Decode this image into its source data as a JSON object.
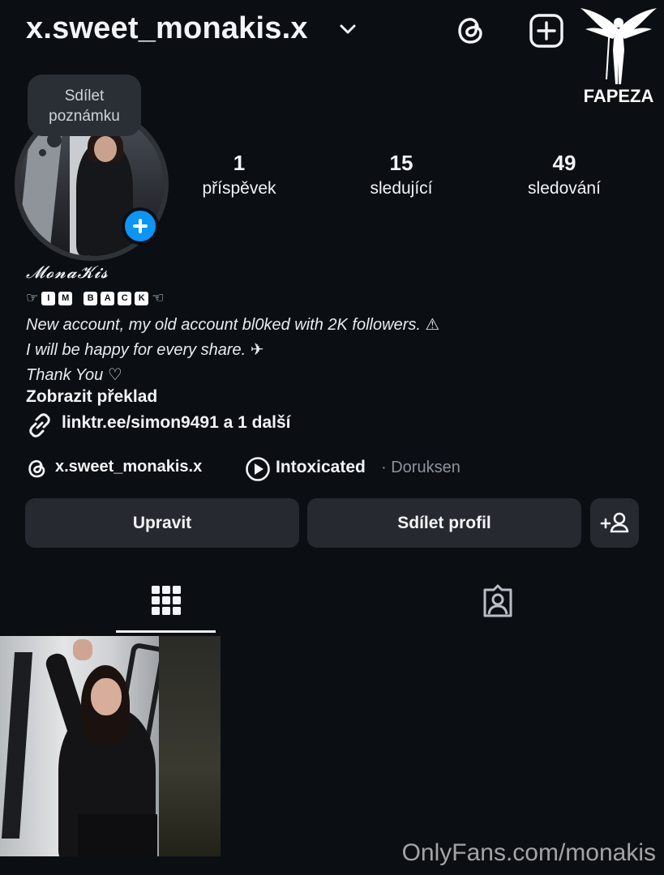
{
  "header": {
    "username": "x.sweet_monakis.x",
    "icons": [
      "chevron-down-icon",
      "threads-icon",
      "add-post-icon"
    ],
    "watermark": "FAPEZA"
  },
  "profile": {
    "note_label": "Sdílet poznámku",
    "stats": [
      {
        "count": "1",
        "label": "příspěvek"
      },
      {
        "count": "15",
        "label": "sledující"
      },
      {
        "count": "49",
        "label": "sledování"
      }
    ],
    "display_name": "𝓜𝓸𝓷𝓪𝓚𝓲𝓼",
    "im_back": {
      "left": "☞",
      "letters": [
        "I",
        "M",
        "B",
        "A",
        "C",
        "K"
      ],
      "right": "☜"
    },
    "bio_lines": [
      "New account, my old account bl0ked with 2K followers. ⚠",
      "I will be happy for every share. ✈",
      "Thank You ♡"
    ],
    "translate_label": "Zobrazit překlad",
    "link_text": "linktr.ee/simon9491 a 1 další",
    "threads_handle": "x.sweet_monakis.x",
    "song_title": "Intoxicated",
    "song_artist": "· Doruksen"
  },
  "buttons": {
    "edit": "Upravit",
    "share": "Sdílet profil"
  },
  "tabs": [
    {
      "name": "posts-grid",
      "active": true
    },
    {
      "name": "tagged",
      "active": false
    }
  ],
  "footer": {
    "watermark": "OnlyFans.com/monakis"
  },
  "colors": {
    "background": "#0b0f14",
    "button": "#262a30",
    "accent_blue": "#0a95f7",
    "muted_text": "#8d939b"
  }
}
